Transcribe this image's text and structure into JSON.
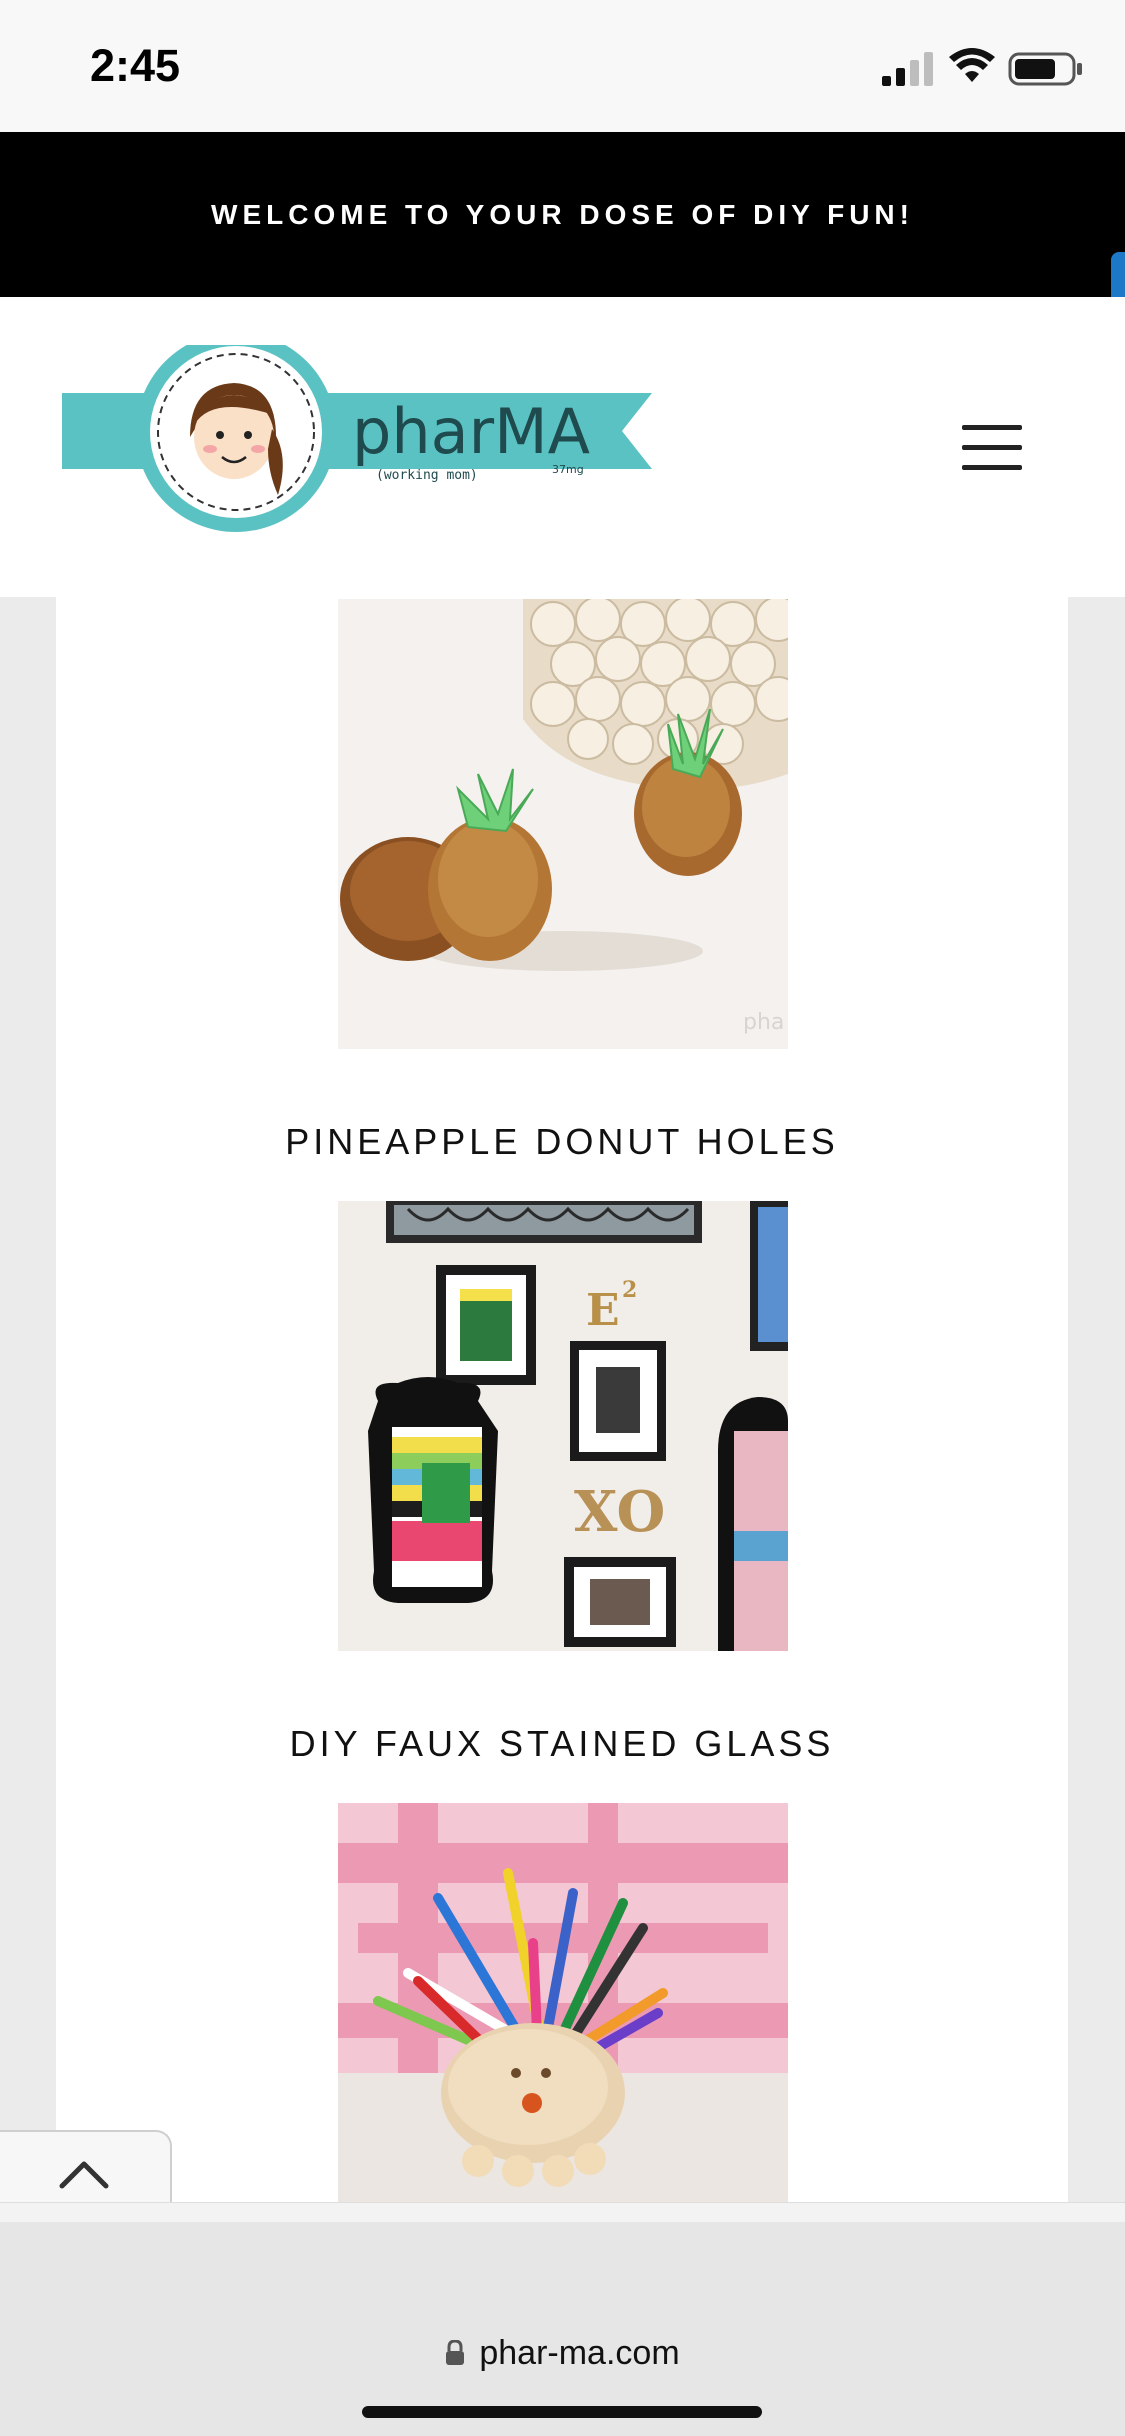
{
  "status_bar": {
    "time": "2:45",
    "icons": [
      "signal-icon",
      "wifi-icon",
      "battery-icon"
    ]
  },
  "banner": {
    "text": "WELCOME TO YOUR DOSE OF DIY FUN!"
  },
  "header": {
    "logo_text": "pharMA",
    "logo_subtext": "(working mom)",
    "logo_dose": "37mg",
    "menu_icon": "hamburger-menu-icon"
  },
  "posts": [
    {
      "title": "PINEAPPLE DONUT HOLES",
      "image_icon": "pineapple-donut-holes-photo"
    },
    {
      "title": "DIY FAUX STAINED GLASS",
      "image_icon": "gallery-wall-photo"
    },
    {
      "title": "",
      "image_icon": "hedgehog-pencil-holder-photo"
    }
  ],
  "back_to_top": {
    "icon": "chevron-up-icon"
  },
  "browser": {
    "url": "phar-ma.com",
    "lock_icon": "lock-icon"
  },
  "colors": {
    "banner_bg": "#000000",
    "logo_teal": "#5bc2c3",
    "logo_dark": "#1f4a4e",
    "side_tab": "#1d79c7"
  }
}
